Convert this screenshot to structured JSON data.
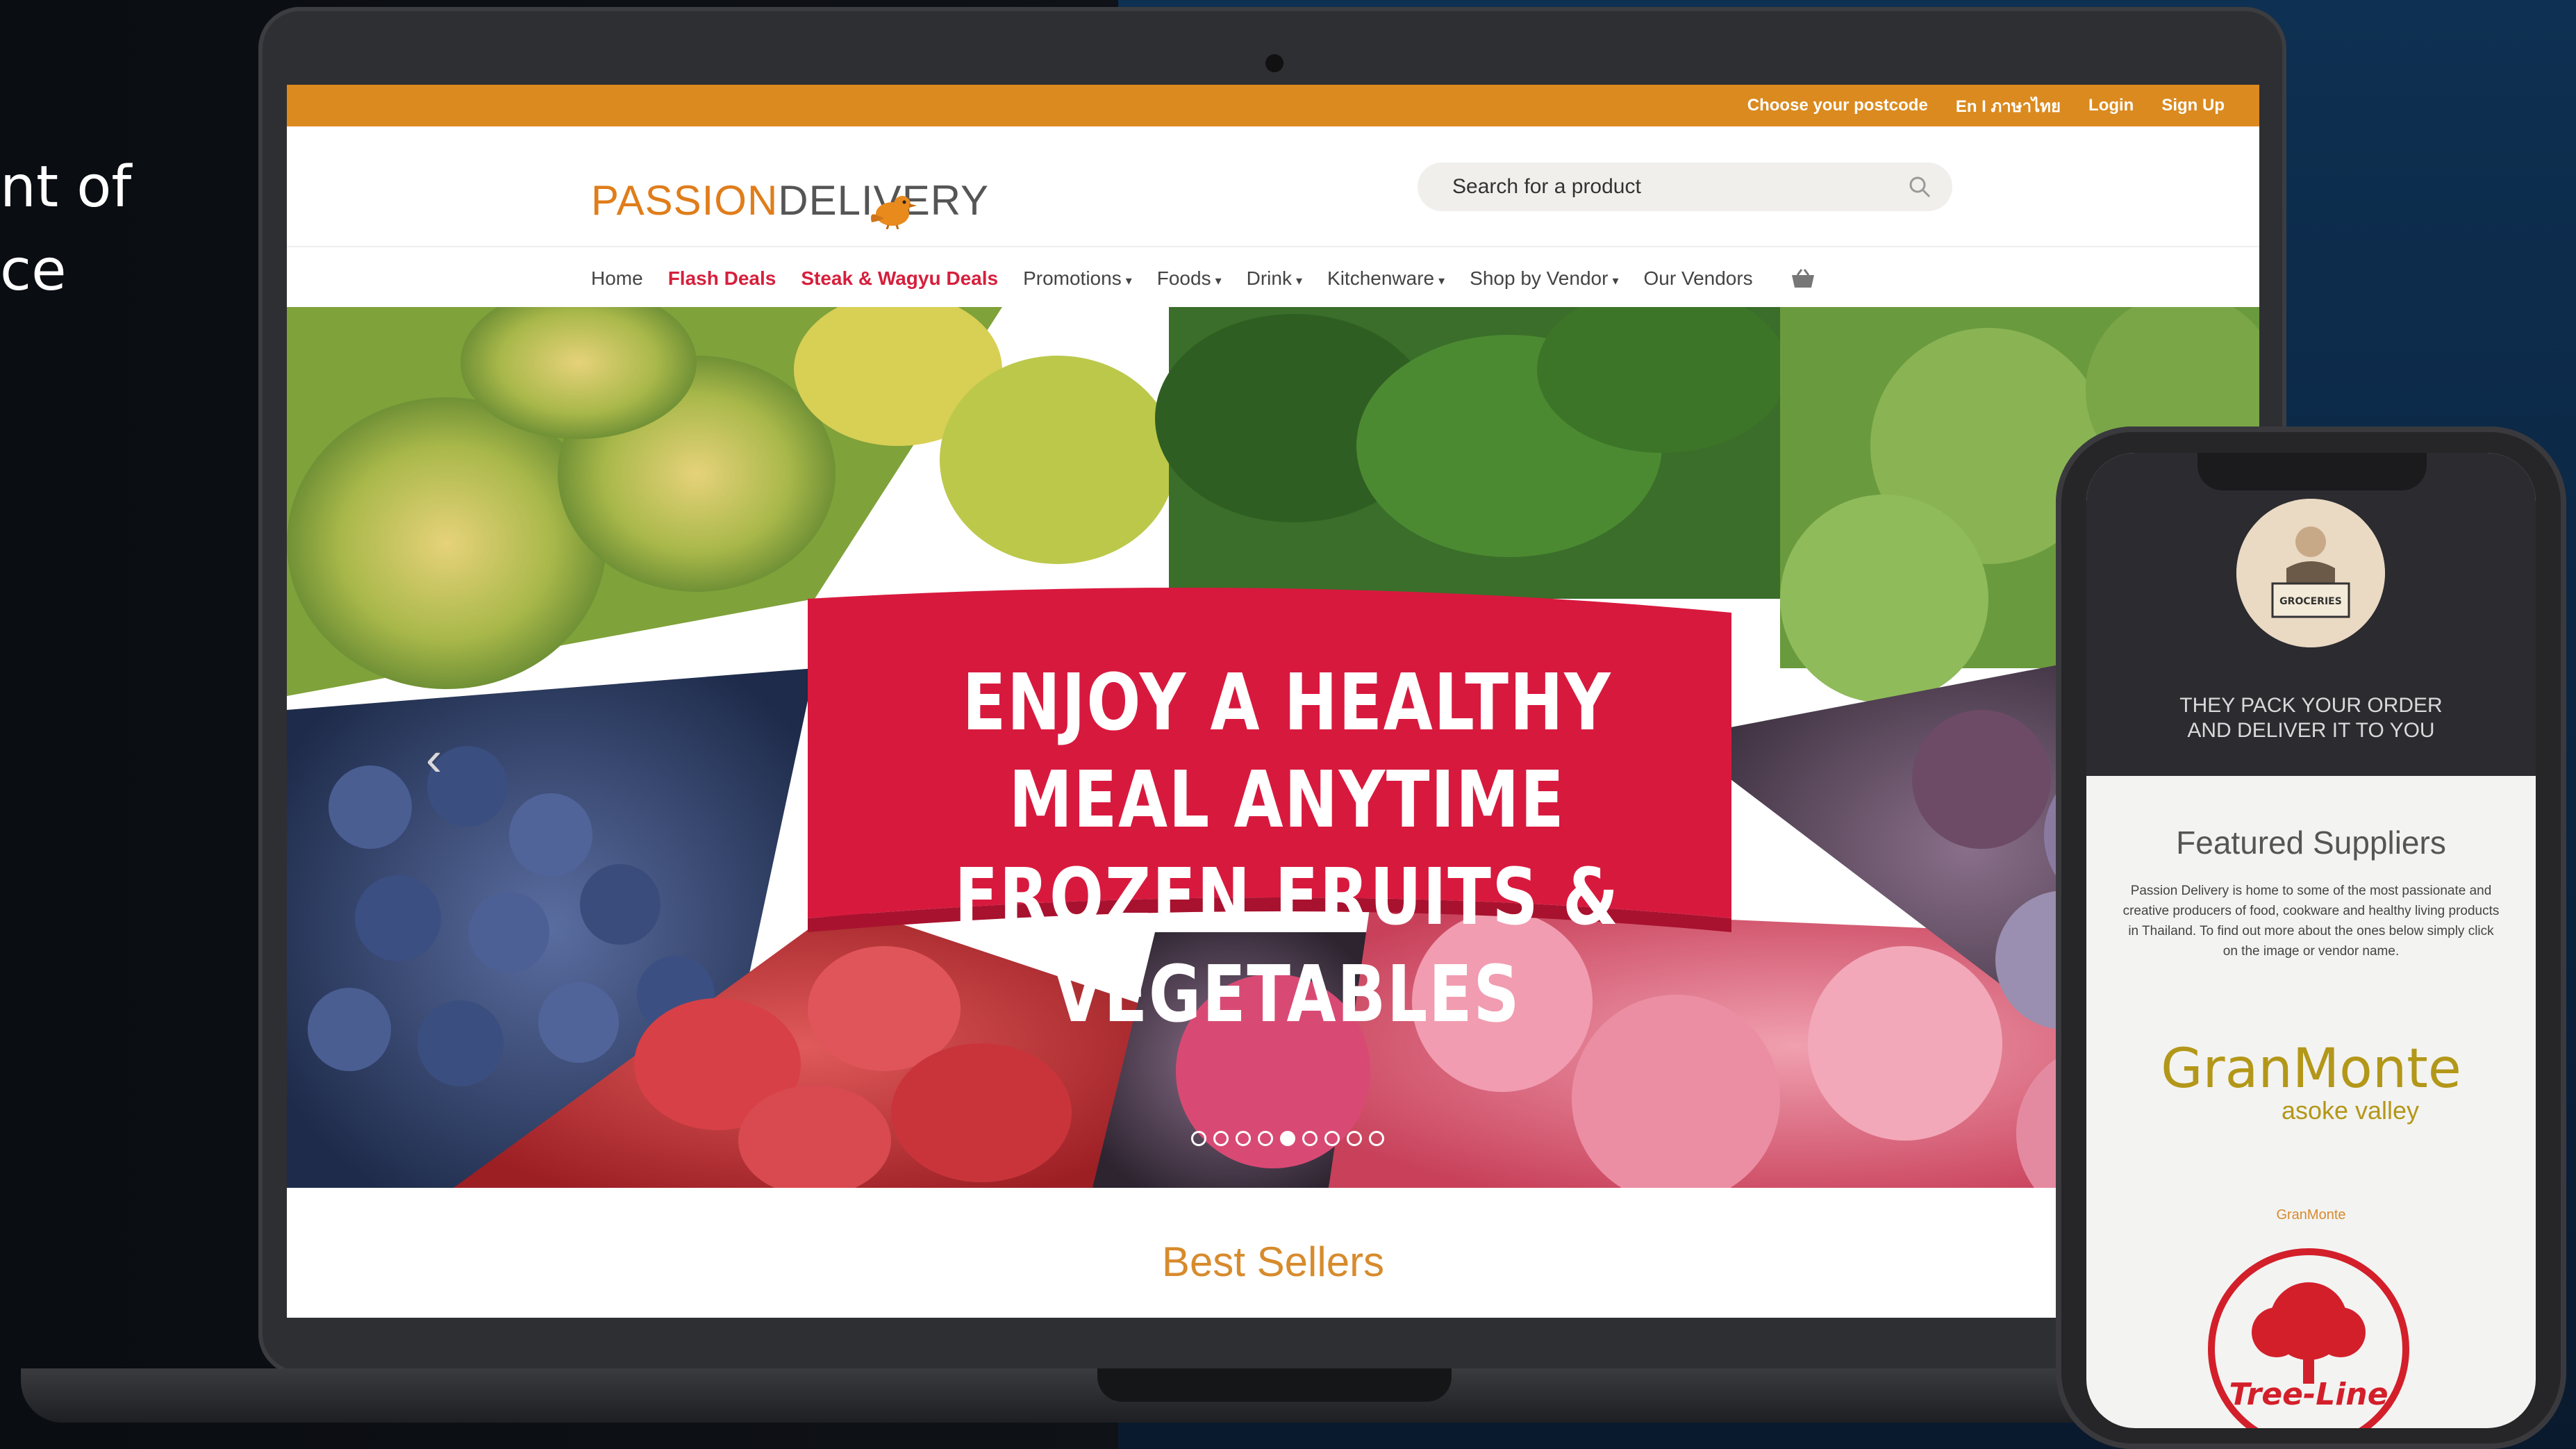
{
  "side": {
    "line1": "nt of",
    "line2": "ce"
  },
  "site": {
    "topbar": {
      "postcode": "Choose your postcode",
      "lang": "En I ภาษาไทย",
      "login": "Login",
      "signup": "Sign Up"
    },
    "logo": {
      "part1": "PASSION",
      "part2": "DELIVERY"
    },
    "search": {
      "placeholder": "Search for a product"
    },
    "nav": {
      "home": "Home",
      "flash": "Flash Deals",
      "steak": "Steak & Wagyu Deals",
      "promotions": "Promotions",
      "foods": "Foods",
      "drink": "Drink",
      "kitchenware": "Kitchenware",
      "shop_by_vendor": "Shop by Vendor",
      "our_vendors": "Our Vendors"
    },
    "banner": {
      "line1": "ENJOY A HEALTHY MEAL ANYTIME",
      "line2": "FROZEN FRUITS & VEGETABLES",
      "slides": 9,
      "active_slide": 5
    },
    "best_sellers": "Best Sellers"
  },
  "phone": {
    "tagline1": "THEY PACK YOUR ORDER",
    "tagline2": "AND DELIVER IT TO YOU",
    "avatar_text": "GROCERIES",
    "featured_title": "Featured Suppliers",
    "featured_desc": "Passion Delivery is home to some of the most passionate and creative producers of food, cookware and healthy living products in Thailand. To find out more about the ones below simply click on the image or vendor name.",
    "granmonte_logo": "GranMonte",
    "granmonte_sub": "asoke valley",
    "granmonte_caption": "GranMonte",
    "treeline_logo": "Tree-Line"
  },
  "colors": {
    "topbar": "#db8a1f",
    "accent_red": "#d61f3c",
    "banner_red": "#d8193e",
    "best_sellers": "#d78b2d",
    "granmonte": "#b39718"
  }
}
